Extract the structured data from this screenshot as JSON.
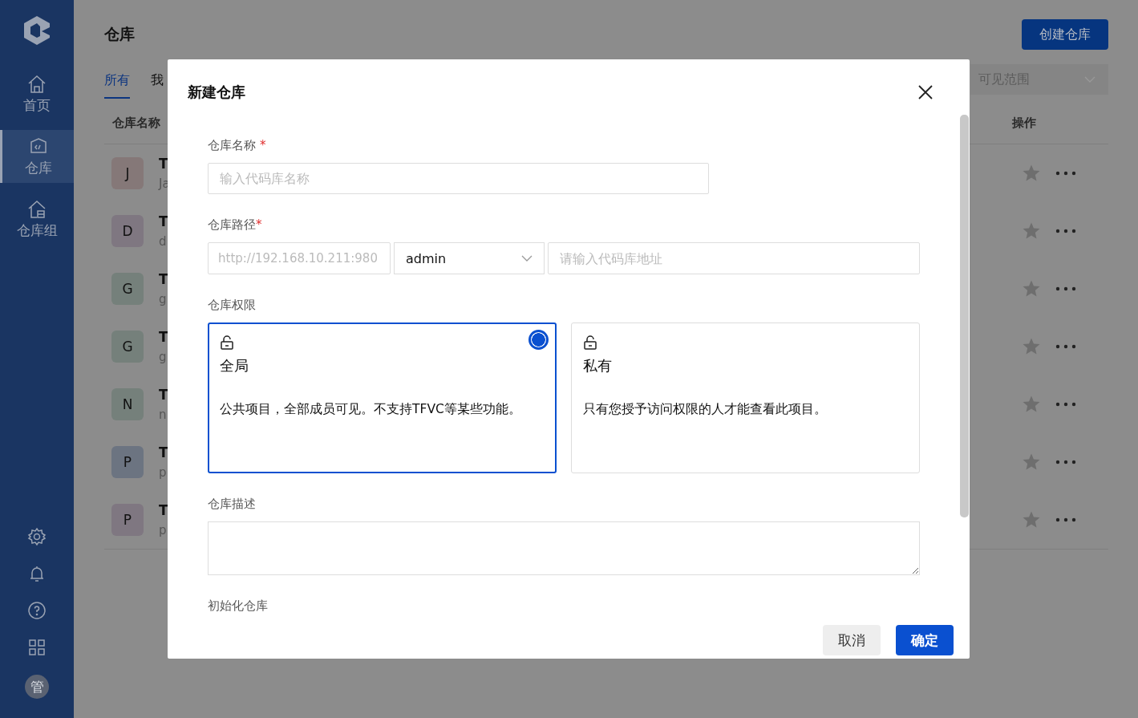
{
  "sidebar": {
    "items": [
      {
        "label": "首页",
        "selected": false
      },
      {
        "label": "仓库",
        "selected": true
      },
      {
        "label": "仓库组",
        "selected": false
      }
    ],
    "avatar": "管"
  },
  "page": {
    "title": "仓库",
    "create_button": "创建仓库",
    "tabs": [
      {
        "label": "所有",
        "selected": true
      },
      {
        "label": "我",
        "selected": false
      }
    ],
    "filter": {
      "placeholder": "可见范围"
    },
    "columns": [
      "仓库名称",
      "操作"
    ],
    "rows": [
      {
        "initial": "J",
        "color": "#857878",
        "title": "T",
        "subtitle": "Ja"
      },
      {
        "initial": "D",
        "color": "#7f7781",
        "title": "T",
        "subtitle": "d"
      },
      {
        "initial": "G",
        "color": "#75807b",
        "title": "T",
        "subtitle": "g"
      },
      {
        "initial": "G",
        "color": "#75807b",
        "title": "T",
        "subtitle": "g"
      },
      {
        "initial": "N",
        "color": "#75807b",
        "title": "T",
        "subtitle": "n"
      },
      {
        "initial": "P",
        "color": "#6c7481",
        "title": "T",
        "subtitle": "p"
      },
      {
        "initial": "P",
        "color": "#7f7781",
        "title": "T",
        "subtitle": "p"
      }
    ]
  },
  "dialog": {
    "title": "新建仓库",
    "name": {
      "label": "仓库名称",
      "required_mark": "*",
      "placeholder": "输入代码库名称"
    },
    "path": {
      "label": "仓库路径",
      "required_mark": "*",
      "prefix": "http://192.168.10.211:980",
      "owner": "admin",
      "placeholder": "请输入代码库地址"
    },
    "permission": {
      "label": "仓库权限",
      "options": [
        {
          "title": "全局",
          "description": "公共项目，全部成员可见。不支持TFVC等某些功能。",
          "selected": true
        },
        {
          "title": "私有",
          "description": "只有您授予访问权限的人才能查看此项目。",
          "selected": false
        }
      ]
    },
    "description": {
      "label": "仓库描述"
    },
    "init": {
      "label": "初始化仓库"
    },
    "buttons": [
      {
        "label": "取消",
        "kind": "secondary"
      },
      {
        "label": "确定",
        "kind": "primary"
      }
    ]
  }
}
